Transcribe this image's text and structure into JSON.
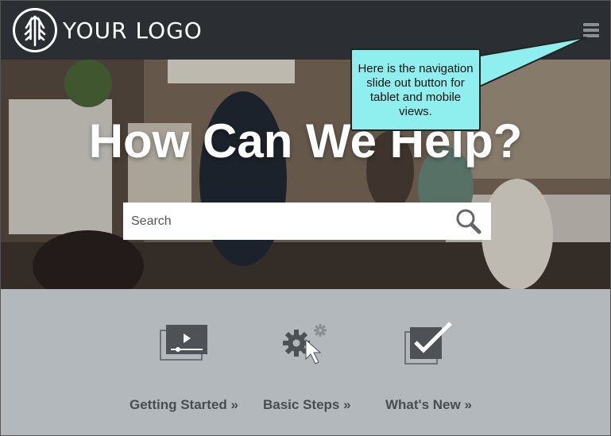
{
  "header": {
    "logo_text": "YOUR LOGO",
    "menu_icon": "hamburger-menu-icon"
  },
  "hero": {
    "title": "How Can We Help?",
    "search": {
      "placeholder": "Search",
      "value": "",
      "icon": "search-icon"
    }
  },
  "callout": {
    "text": "Here is the navigation slide out button for tablet and mobile views.",
    "color": "#8fefef"
  },
  "features": [
    {
      "label": "Getting Started »",
      "icon": "video-player-icon"
    },
    {
      "label": "Basic Steps »",
      "icon": "gears-cursor-icon"
    },
    {
      "label": "What's New »",
      "icon": "checkbox-icon"
    }
  ],
  "colors": {
    "header_bg": "#2b2f33",
    "lower_bg": "#b3b8bc",
    "feature_text": "#4a4d50"
  }
}
